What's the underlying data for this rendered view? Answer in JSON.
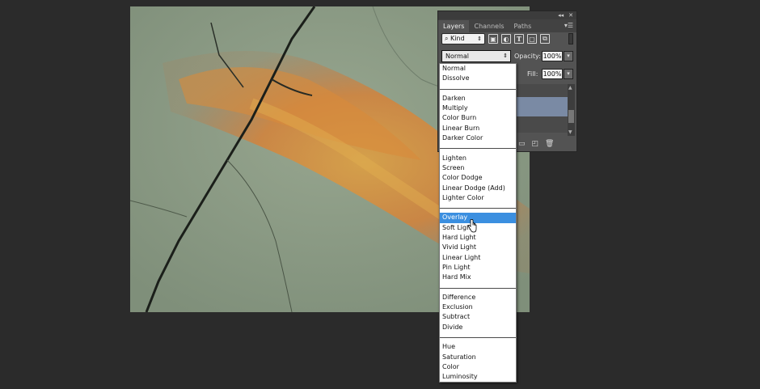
{
  "panel": {
    "tabs": [
      {
        "label": "Layers",
        "active": true
      },
      {
        "label": "Channels",
        "active": false
      },
      {
        "label": "Paths",
        "active": false
      }
    ],
    "topbar_icons": [
      "collapse-icon",
      "close-icon"
    ],
    "kind_label": "Kind",
    "filter_icons": [
      "pixel-filter-icon",
      "adjustment-filter-icon",
      "type-filter-icon",
      "shape-filter-icon",
      "smart-object-filter-icon"
    ],
    "blend_mode": "Normal",
    "opacity_label": "Opacity:",
    "opacity_value": "100%",
    "fill_label": "Fill:",
    "fill_value": "100%",
    "bottom_icons": [
      "folder-icon",
      "new-layer-icon",
      "trash-icon"
    ]
  },
  "dropdown": {
    "groups": [
      [
        "Normal",
        "Dissolve"
      ],
      [
        "Darken",
        "Multiply",
        "Color Burn",
        "Linear Burn",
        "Darker Color"
      ],
      [
        "Lighten",
        "Screen",
        "Color Dodge",
        "Linear Dodge (Add)",
        "Lighter Color"
      ],
      [
        "Overlay",
        "Soft Light",
        "Hard Light",
        "Vivid Light",
        "Linear Light",
        "Pin Light",
        "Hard Mix"
      ],
      [
        "Difference",
        "Exclusion",
        "Subtract",
        "Divide"
      ],
      [
        "Hue",
        "Saturation",
        "Color",
        "Luminosity"
      ]
    ],
    "selected": "Overlay"
  },
  "colors": {
    "app_background": "#2b2b2b",
    "panel_background": "#535353",
    "selection": "#3b8fe0",
    "canvas_stone": "#8c9c86",
    "fossil_orange": "#d9893a"
  }
}
